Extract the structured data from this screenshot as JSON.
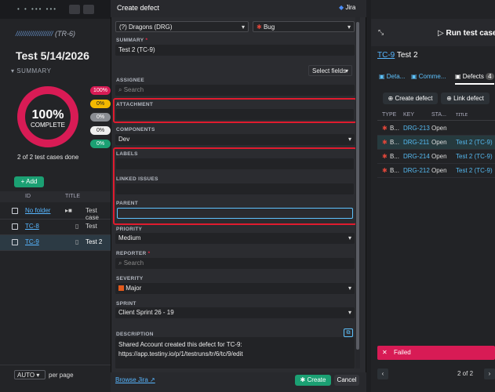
{
  "left": {
    "breadcrumb": "(TR-6)",
    "title": "Test 5/14/2026",
    "summary_label": "SUMMARY",
    "ring_percent": "100%",
    "ring_label": "COMPLETE",
    "pills": [
      "100%",
      "0%",
      "0%",
      "0%",
      "0%"
    ],
    "done_text": "2 of 2 test cases done",
    "add_label": "Add",
    "table_headers": {
      "id": "ID",
      "title": "TITLE"
    },
    "rows": [
      {
        "id": "No folder",
        "title": "Test case"
      },
      {
        "id": "TC-8",
        "title": "Test"
      },
      {
        "id": "TC-9",
        "title": "Test 2"
      }
    ],
    "auto_label": "AUTO",
    "per_page": "per page"
  },
  "modal": {
    "title": "Create defect",
    "jira_label": "Jira",
    "project": "(?) Dragons (DRG)",
    "issue_type": "Bug",
    "labels": {
      "summary": "SUMMARY",
      "assignee": "ASSIGNEE",
      "attachment": "ATTACHMENT",
      "components": "COMPONENTS",
      "labels": "LABELS",
      "linked_issues": "LINKED ISSUES",
      "parent": "PARENT",
      "priority": "PRIORITY",
      "reporter": "REPORTER",
      "severity": "SEVERITY",
      "sprint": "SPRINT",
      "description": "DESCRIPTION"
    },
    "summary_value": "Test 2 (TC-9)",
    "select_fields": "Select fields",
    "assignee_placeholder": "Search",
    "components_value": "Dev",
    "parent_value": "",
    "priority_value": "Medium",
    "reporter_placeholder": "Search",
    "severity_value": "Major",
    "sprint_value": "Client Sprint 26 - 19",
    "description_line1": "Shared  Account created this defect for TC-9:",
    "description_line2": "https://app.testiny.io/p/1/testruns/tr/6/tc/9/edit",
    "browse": "Browse Jira",
    "create": "Create",
    "cancel": "Cancel"
  },
  "right": {
    "run_title": "Run test case",
    "tc_id": "TC-9",
    "tc_title": "Test 2",
    "tabs": [
      "Deta...",
      "Comme...",
      "Defects"
    ],
    "defects_count": "4",
    "create_defect": "Create defect",
    "link_defect": "Link defect",
    "headers": {
      "type": "TYPE",
      "key": "KEY",
      "status": "STA..."
    },
    "defects": [
      {
        "type": "B...",
        "key": "DRG-213",
        "status": "Open",
        "title": ""
      },
      {
        "type": "B...",
        "key": "DRG-211",
        "status": "Open",
        "title": "Test 2 (TC-9)"
      },
      {
        "type": "B...",
        "key": "DRG-214",
        "status": "Open",
        "title": "Test 2 (TC-9)"
      },
      {
        "type": "B...",
        "key": "DRG-212",
        "status": "Open",
        "title": "Test 2 (TC-9)"
      }
    ],
    "failed": "Failed",
    "pager": "2 of 2"
  }
}
